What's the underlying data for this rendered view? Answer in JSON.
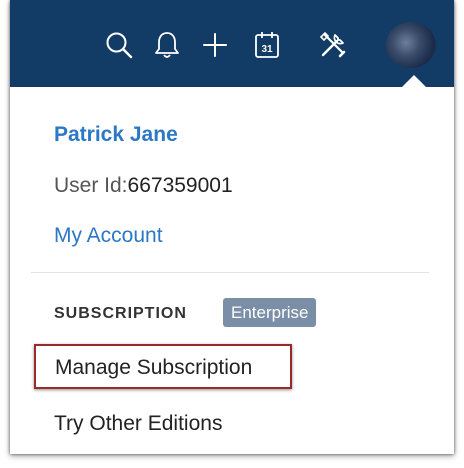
{
  "topbar": {
    "icons": [
      "search-icon",
      "bell-icon",
      "plus-icon",
      "calendar-icon",
      "tools-icon"
    ],
    "calendar_day": "31",
    "background_color": "#123c66"
  },
  "user": {
    "name": "Patrick Jane",
    "id_label": "User Id:",
    "id_value": "667359001",
    "my_account_label": "My Account"
  },
  "subscription": {
    "section_label": "SUBSCRIPTION",
    "edition": "Enterprise",
    "manage_label": "Manage Subscription",
    "try_other_label": "Try Other Editions"
  },
  "colors": {
    "link": "#2a78c6",
    "badge": "#7b8ea8",
    "highlight_border": "#9a2a2a"
  }
}
